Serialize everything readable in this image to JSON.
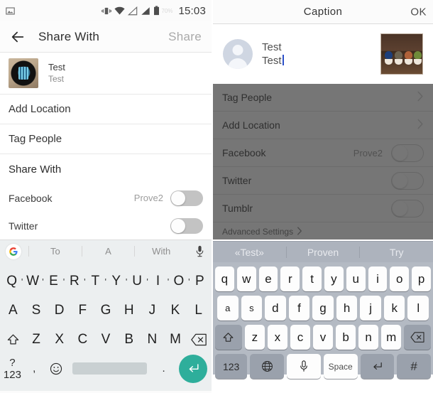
{
  "left": {
    "status_bar": {
      "time": "15:03",
      "battery_pct": "70%",
      "icons": [
        "image-icon",
        "vibrate-icon",
        "wifi-icon",
        "signal-1-icon",
        "signal-2-icon",
        "battery-icon"
      ]
    },
    "appbar": {
      "title": "Share With",
      "action": "Share",
      "back_icon": "back-arrow-icon"
    },
    "post": {
      "title": "Test",
      "subtitle": "Test",
      "thumb": "watch-photo-thumbnail"
    },
    "rows": [
      {
        "label": "Add Location"
      },
      {
        "label": "Tag People"
      }
    ],
    "section_title": "Share With",
    "toggles": [
      {
        "label": "Facebook",
        "account": "Prove2",
        "on": false
      },
      {
        "label": "Twitter",
        "account": "",
        "on": false
      }
    ],
    "suggestions": {
      "logo": "google-g-icon",
      "items": [
        "To",
        "A",
        "With"
      ],
      "mic": "microphone-icon"
    },
    "keyboard": {
      "row1": [
        "Q",
        "W",
        "E",
        "R",
        "T",
        "Y",
        "U",
        "I",
        "O",
        "P"
      ],
      "row2": [
        "A",
        "S",
        "D",
        "F",
        "G",
        "H",
        "J",
        "K",
        "L"
      ],
      "row3_shift": "shift-icon",
      "row3": [
        "Z",
        "X",
        "C",
        "V",
        "B",
        "N",
        "M"
      ],
      "row3_backspace": "backspace-icon",
      "row4_numbers": "?123",
      "row4_comma": ",",
      "row4_emoji": "emoji-icon",
      "row4_space": "",
      "row4_period": ".",
      "row4_enter": "enter-icon"
    }
  },
  "right": {
    "topbar": {
      "title": "Caption",
      "action": "OK"
    },
    "caption": {
      "line1": "Test",
      "line2": "Test",
      "avatar": "default-avatar-icon",
      "photo": "plants-photo-thumbnail"
    },
    "rows": [
      {
        "label": "Tag People",
        "chevron": "chevron-right-icon"
      },
      {
        "label": "Add Location",
        "chevron": "chevron-right-icon"
      }
    ],
    "toggles": [
      {
        "label": "Facebook",
        "account": "Prove2",
        "on": false
      },
      {
        "label": "Twitter",
        "account": "",
        "on": false
      },
      {
        "label": "Tumblr",
        "account": "",
        "on": false
      }
    ],
    "advanced": {
      "label": "Advanced Settings",
      "chevron": "chevron-right-icon"
    },
    "suggestions": [
      "«Test»",
      "Proven",
      "Try"
    ],
    "keyboard": {
      "row1": [
        "q",
        "w",
        "e",
        "r",
        "t",
        "y",
        "u",
        "i",
        "o",
        "p"
      ],
      "row2": [
        "a",
        "s",
        "d",
        "f",
        "g",
        "h",
        "j",
        "k",
        "l"
      ],
      "row3_shift": "shift-icon",
      "row3": [
        "z",
        "x",
        "c",
        "v",
        "b",
        "n",
        "m"
      ],
      "row3_backspace": "backspace-icon",
      "row4_numbers": "123",
      "row4_globe": "globe-icon",
      "row4_mic": "microphone-icon",
      "row4_space": "Space",
      "row4_return": "return-icon",
      "row4_hash": "#"
    }
  },
  "colors": {
    "accent_enter": "#2eae9b",
    "ios_keyboard_bg": "#b4bac3",
    "dim_overlay": "rgba(40,40,40,.64)",
    "caret": "#2b50c8"
  }
}
